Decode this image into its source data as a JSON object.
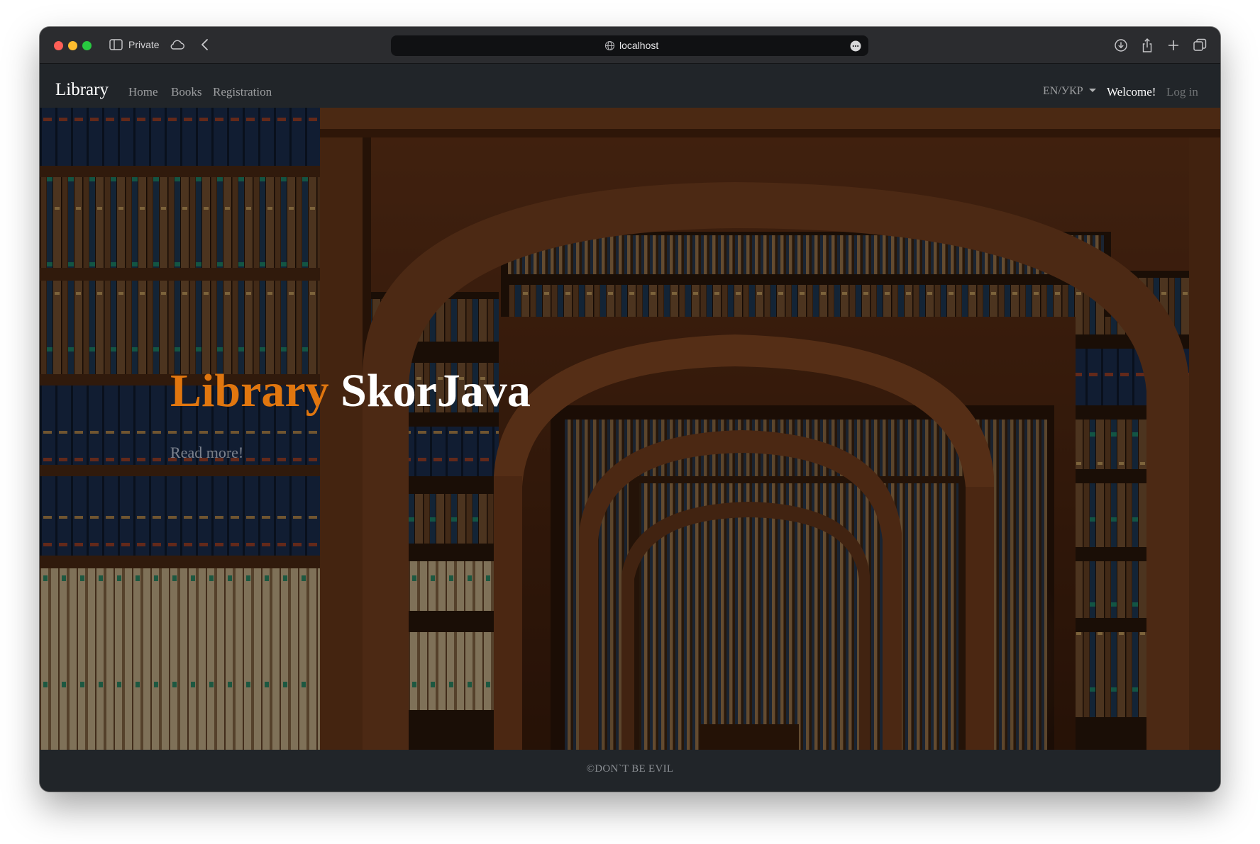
{
  "browser": {
    "private_label": "Private",
    "url": "localhost",
    "icons": [
      "sidebar-toggle-icon",
      "cloud-icon",
      "back-chevron-icon",
      "globe-icon",
      "more-icon",
      "download-icon",
      "share-icon",
      "new-tab-plus-icon",
      "tabs-overview-icon"
    ]
  },
  "navbar": {
    "brand": "Library",
    "links": [
      {
        "label": "Home"
      },
      {
        "label": "Books"
      },
      {
        "label": "Registration"
      }
    ],
    "language_toggle": "EN/УКР",
    "welcome": "Welcome!",
    "login": "Log in"
  },
  "hero": {
    "heading_accent": "Library",
    "heading_main": "SkorJava",
    "read_more": "Read more!"
  },
  "footer": {
    "text": "©DON`T BE EVIL"
  },
  "colors": {
    "navbar_bg": "#212529",
    "accent_orange": "#e0760f",
    "chrome_bg": "#2b2c2f"
  }
}
